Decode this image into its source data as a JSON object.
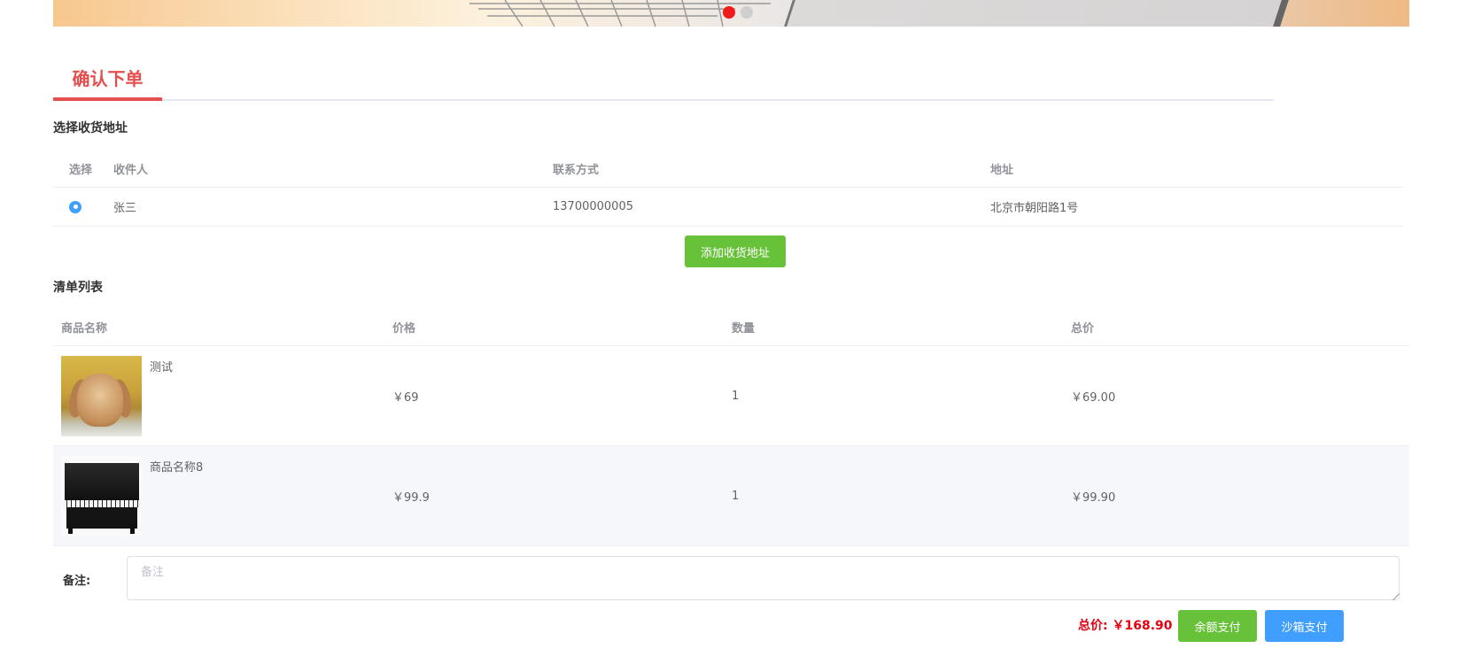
{
  "banner": {
    "slides": 2,
    "active_slide": 1
  },
  "section_title": "确认下单",
  "address_section": {
    "title": "选择收货地址",
    "columns": [
      "选择",
      "收件人",
      "联系方式",
      "地址"
    ],
    "rows": [
      {
        "selected": true,
        "name": "张三",
        "phone": "13700000005",
        "address": "北京市朝阳路1号"
      }
    ],
    "add_button": "添加收货地址"
  },
  "items_section": {
    "title": "清单列表",
    "columns": [
      "商品名称",
      "价格",
      "数量",
      "总价"
    ],
    "rows": [
      {
        "name": "测试",
        "price": "￥69",
        "quantity": "1",
        "total": "￥69.00",
        "image": "bunny-image"
      },
      {
        "name": "商品名称8",
        "price": "￥99.9",
        "quantity": "1",
        "total": "￥99.90",
        "image": "piano-image"
      }
    ]
  },
  "remark": {
    "label": "备注:",
    "placeholder": "备注",
    "value": ""
  },
  "footer": {
    "total_label": "总价:",
    "total_value": "￥168.90",
    "balance_pay": "余额支付",
    "sandbox_pay": "沙箱支付"
  },
  "colors": {
    "accent_red": "#e54e4e",
    "price_red": "#e60012",
    "green": "#67c23a",
    "blue": "#409eff"
  }
}
